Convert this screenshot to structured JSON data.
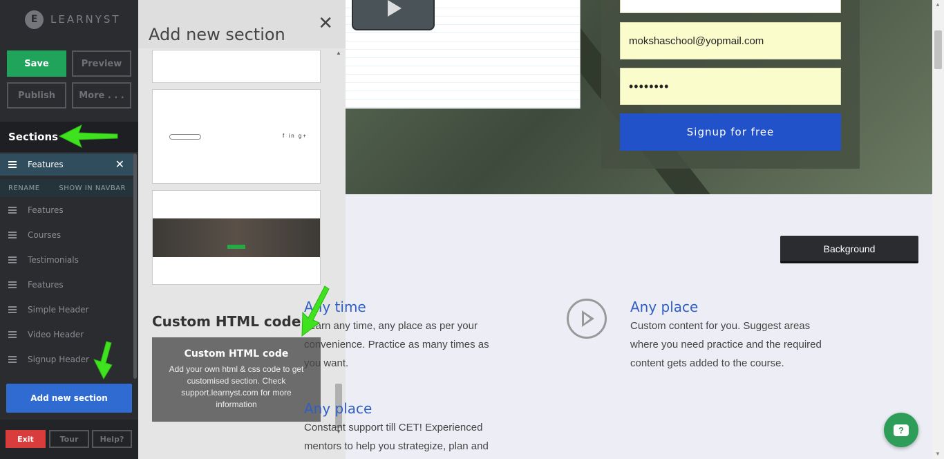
{
  "app": {
    "logo_text": "LEARNYST",
    "logo_letter": "E"
  },
  "toolbar": {
    "save": "Save",
    "preview": "Preview",
    "publish": "Publish",
    "more": "More . . ."
  },
  "sidebar": {
    "sections_heading": "Sections",
    "active_item": {
      "label": "Features",
      "rename": "RENAME",
      "show_in_navbar": "SHOW IN NAVBAR"
    },
    "items": [
      "Features",
      "Courses",
      "Testimonials",
      "Features",
      "Simple Header",
      "Video Header",
      "Signup Header"
    ],
    "add_section": "Add new section",
    "exit": "Exit",
    "tour": "Tour",
    "help": "Help?"
  },
  "panel": {
    "title": "Add new section",
    "custom_title": "Custom HTML code",
    "custom_card_title": "Custom HTML code",
    "custom_card_desc": "Add your own html & css code to get customised section. Check support.learnyst.com for more information"
  },
  "hero": {
    "email_value": "mokshaschool@yopmail.com",
    "password_mask": "••••••••",
    "signup_label": "Signup for free"
  },
  "content": {
    "background_button": "Background",
    "features": [
      {
        "title": "Any time",
        "desc": "Learn any time, any place as per your convenience. Practice as many times as you want."
      },
      {
        "title": "Any place",
        "desc": "Custom content for you. Suggest areas where you need practice and the required content gets added to the course."
      },
      {
        "title": "Any place",
        "desc": "Constant support till CET! Experienced mentors to help you strategize, plan and"
      }
    ]
  },
  "colors": {
    "accent": "#2152c9",
    "save": "#20a35a",
    "exit": "#d93c3c",
    "arrow": "#3ee21f"
  }
}
